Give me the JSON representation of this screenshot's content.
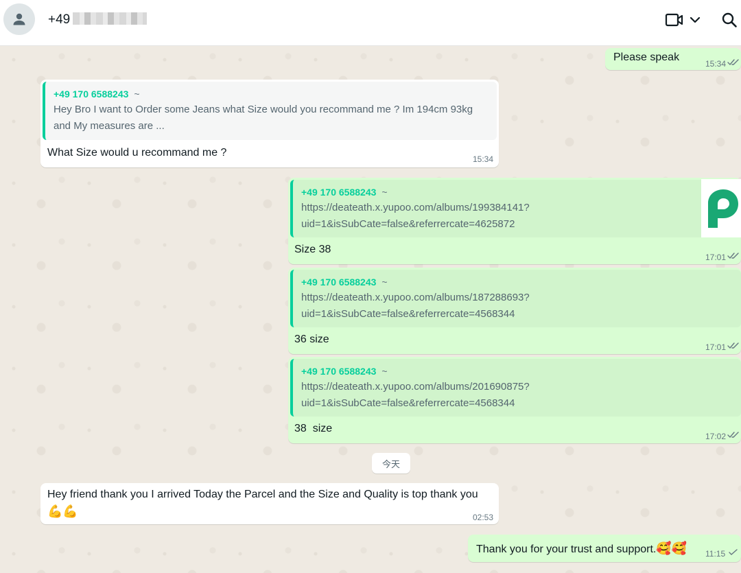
{
  "header": {
    "contact_prefix": "+49",
    "avatar_icon": "person-icon",
    "video_icon": "video-camera-icon",
    "dropdown_icon": "chevron-down-icon",
    "search_icon": "search-icon"
  },
  "colors": {
    "incoming_bubble": "#ffffff",
    "outgoing_bubble": "#d9fdd3",
    "quote_accent": "#06cf9c",
    "chat_background": "#efeae2",
    "read_tick": "#667781"
  },
  "messages": [
    {
      "direction": "out",
      "text": "Please speak",
      "time": "15:34",
      "status": "read"
    },
    {
      "direction": "in",
      "quote": {
        "sender": "+49 170 6588243",
        "tilde": "~",
        "lines": [
          "Hey Bro I want to Order some Jeans what Size would you recommand me ? Im 194cm 93kg",
          "and My measures are  ..."
        ]
      },
      "text": "What Size would u recommand me ?",
      "time": "15:34"
    },
    {
      "direction": "out",
      "quote": {
        "sender": "+49 170 6588243",
        "tilde": "~",
        "lines": [
          "https://deateath.x.yupoo.com/albums/199384141?",
          "uid=1&isSubCate=false&referrercate=4625872"
        ],
        "thumbnail": "p-logo-icon"
      },
      "text": "Size 38",
      "time": "17:01",
      "status": "read"
    },
    {
      "direction": "out",
      "quote": {
        "sender": "+49 170 6588243",
        "tilde": "~",
        "lines": [
          "https://deateath.x.yupoo.com/albums/187288693?",
          "uid=1&isSubCate=false&referrercate=4568344"
        ]
      },
      "text": "36 size",
      "time": "17:01",
      "status": "read"
    },
    {
      "direction": "out",
      "quote": {
        "sender": "+49 170 6588243",
        "tilde": "~",
        "lines": [
          "https://deateath.x.yupoo.com/albums/201690875?",
          "uid=1&isSubCate=false&referrercate=4568344"
        ]
      },
      "text": "38  size",
      "time": "17:02",
      "status": "read"
    },
    {
      "direction": "in",
      "text": "Hey friend thank you I arrived Today the Parcel and the Size and Quality is top thank you",
      "emoji": "💪💪",
      "time": "02:53"
    },
    {
      "direction": "out",
      "text": "Thank you for your trust and support.",
      "emoji": "🥰🥰",
      "time": "11:15",
      "status": "sent"
    }
  ],
  "date_separator": "今天"
}
